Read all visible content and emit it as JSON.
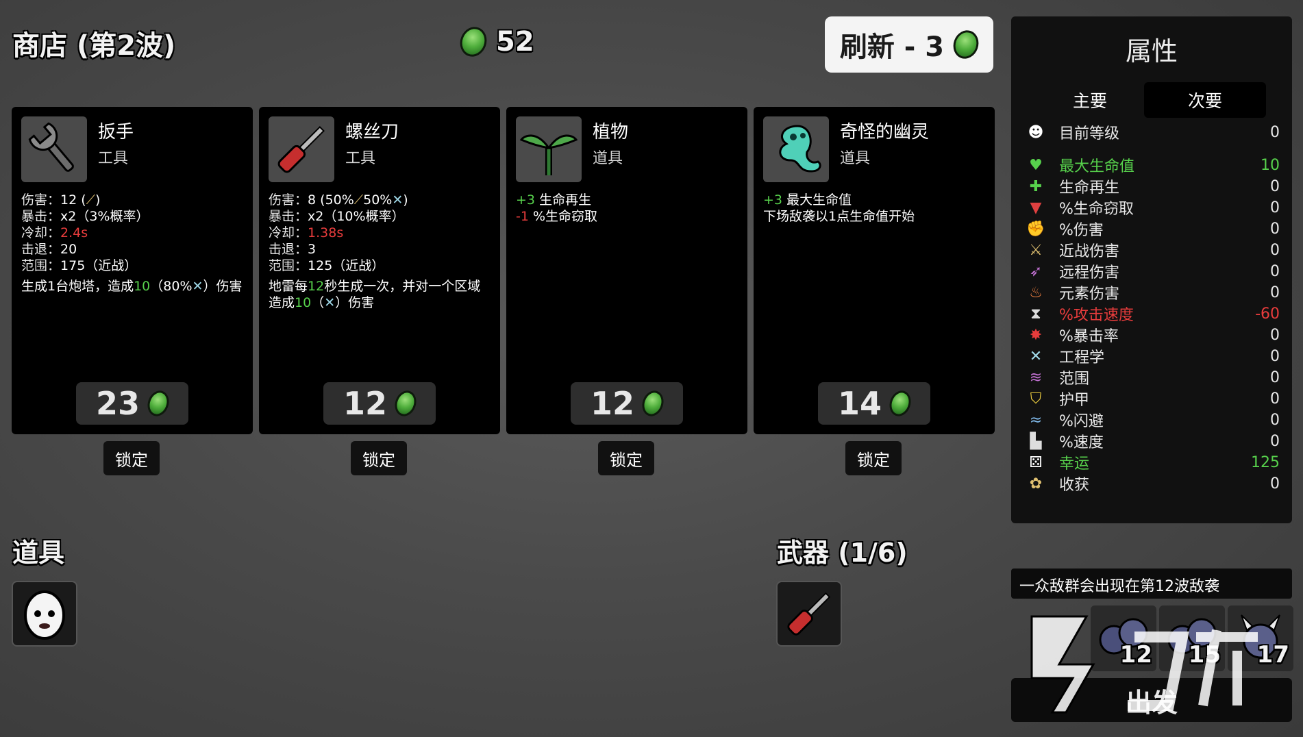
{
  "header": {
    "shop_title": "商店 (第2波)",
    "currency": "52",
    "refresh_label": "刷新 - 3"
  },
  "cards": [
    {
      "name": "扳手",
      "type": "工具",
      "icon": "wrench-icon",
      "stats": {
        "damage_label": "伤害：",
        "damage_value": "12 (",
        "damage_suffix": ")",
        "crit_label": "暴击：",
        "crit_value": "x2（3%概率）",
        "cooldown_label": "冷却：",
        "cooldown_value": "2.4s",
        "knockback_label": "击退：",
        "knockback_value": "20",
        "range_label": "范围：",
        "range_value": "175（近战）"
      },
      "effect_pre": "生成1台炮塔，造成",
      "effect_num": "10",
      "effect_mid": "（80%",
      "effect_post": "）伤害",
      "price": "23",
      "lock_label": "锁定"
    },
    {
      "name": "螺丝刀",
      "type": "工具",
      "icon": "screwdriver-icon",
      "stats": {
        "damage_label": "伤害：",
        "damage_value": "8 (50%",
        "damage_mid": "50%",
        "damage_suffix": ")",
        "crit_label": "暴击：",
        "crit_value": "x2（10%概率）",
        "cooldown_label": "冷却：",
        "cooldown_value": "1.38s",
        "knockback_label": "击退：",
        "knockback_value": "3",
        "range_label": "范围：",
        "range_value": "125（近战）"
      },
      "effect_pre": "地雷每",
      "effect_num": "12",
      "effect_mid": "秒生成一次，并对一个区域造成",
      "effect_num2": "10",
      "effect_post": "（",
      "effect_end": "）伤害",
      "price": "12",
      "lock_label": "锁定"
    },
    {
      "name": "植物",
      "type": "道具",
      "icon": "sprout-icon",
      "line1_num": "+3",
      "line1_text": "生命再生",
      "line2_num": "-1",
      "line2_text": "%生命窃取",
      "price": "12",
      "lock_label": "锁定"
    },
    {
      "name": "奇怪的幽灵",
      "type": "道具",
      "icon": "ghost-icon",
      "line1_num": "+3",
      "line1_text": "最大生命值",
      "line2_text": "下场敌袭以1点生命值开始",
      "price": "14",
      "lock_label": "锁定"
    }
  ],
  "items_section": {
    "title": "道具",
    "items": [
      "egg-creature-icon"
    ]
  },
  "weapons_section": {
    "title": "武器 (1/6)",
    "items": [
      "screwdriver-icon"
    ]
  },
  "stats_panel": {
    "title": "属性",
    "tab_primary": "主要",
    "tab_secondary": "次要",
    "rows": [
      {
        "label": "目前等级",
        "value": "0",
        "icon": "level-icon",
        "color": "#e8e8e8"
      },
      {
        "label": "最大生命值",
        "value": "10",
        "icon": "heart-icon",
        "color": "#57d14c"
      },
      {
        "label": "生命再生",
        "value": "0",
        "icon": "heart-plus-icon",
        "color": "#e8e8e8"
      },
      {
        "label": "%生命窃取",
        "value": "0",
        "icon": "fangs-icon",
        "color": "#e8e8e8"
      },
      {
        "label": "%伤害",
        "value": "0",
        "icon": "fist-icon",
        "color": "#e8e8e8"
      },
      {
        "label": "近战伤害",
        "value": "0",
        "icon": "sword-icon",
        "color": "#e8e8e8"
      },
      {
        "label": "远程伤害",
        "value": "0",
        "icon": "bow-icon",
        "color": "#e8e8e8"
      },
      {
        "label": "元素伤害",
        "value": "0",
        "icon": "flame-icon",
        "color": "#e8e8e8"
      },
      {
        "label": "%攻击速度",
        "value": "-60",
        "icon": "hourglass-icon",
        "color": "#e83c3c"
      },
      {
        "label": "%暴击率",
        "value": "0",
        "icon": "crit-burst-icon",
        "color": "#e8e8e8"
      },
      {
        "label": "工程学",
        "value": "0",
        "icon": "wrench-cross-icon",
        "color": "#e8e8e8"
      },
      {
        "label": "范围",
        "value": "0",
        "icon": "range-waves-icon",
        "color": "#e8e8e8"
      },
      {
        "label": "护甲",
        "value": "0",
        "icon": "shield-icon",
        "color": "#e8e8e8"
      },
      {
        "label": "%闪避",
        "value": "0",
        "icon": "dodge-wind-icon",
        "color": "#e8e8e8"
      },
      {
        "label": "%速度",
        "value": "0",
        "icon": "boot-icon",
        "color": "#e8e8e8"
      },
      {
        "label": "幸运",
        "value": "125",
        "icon": "dice-icon",
        "color": "#57d14c"
      },
      {
        "label": "收获",
        "value": "0",
        "icon": "harvest-icon",
        "color": "#e8e8e8"
      }
    ]
  },
  "wave_info": {
    "banner": "一众敌群会出现在第12波敌袭",
    "enemies": [
      {
        "icon": "enemy-blob-icon",
        "count": "12"
      },
      {
        "icon": "enemy-blob-icon",
        "count": "15"
      },
      {
        "icon": "enemy-horned-icon",
        "count": "17"
      }
    ]
  },
  "depart_label": "出发",
  "colors": {
    "green": "#57d14c",
    "red": "#e83c3c",
    "accent_coin": "#4fae3c"
  }
}
